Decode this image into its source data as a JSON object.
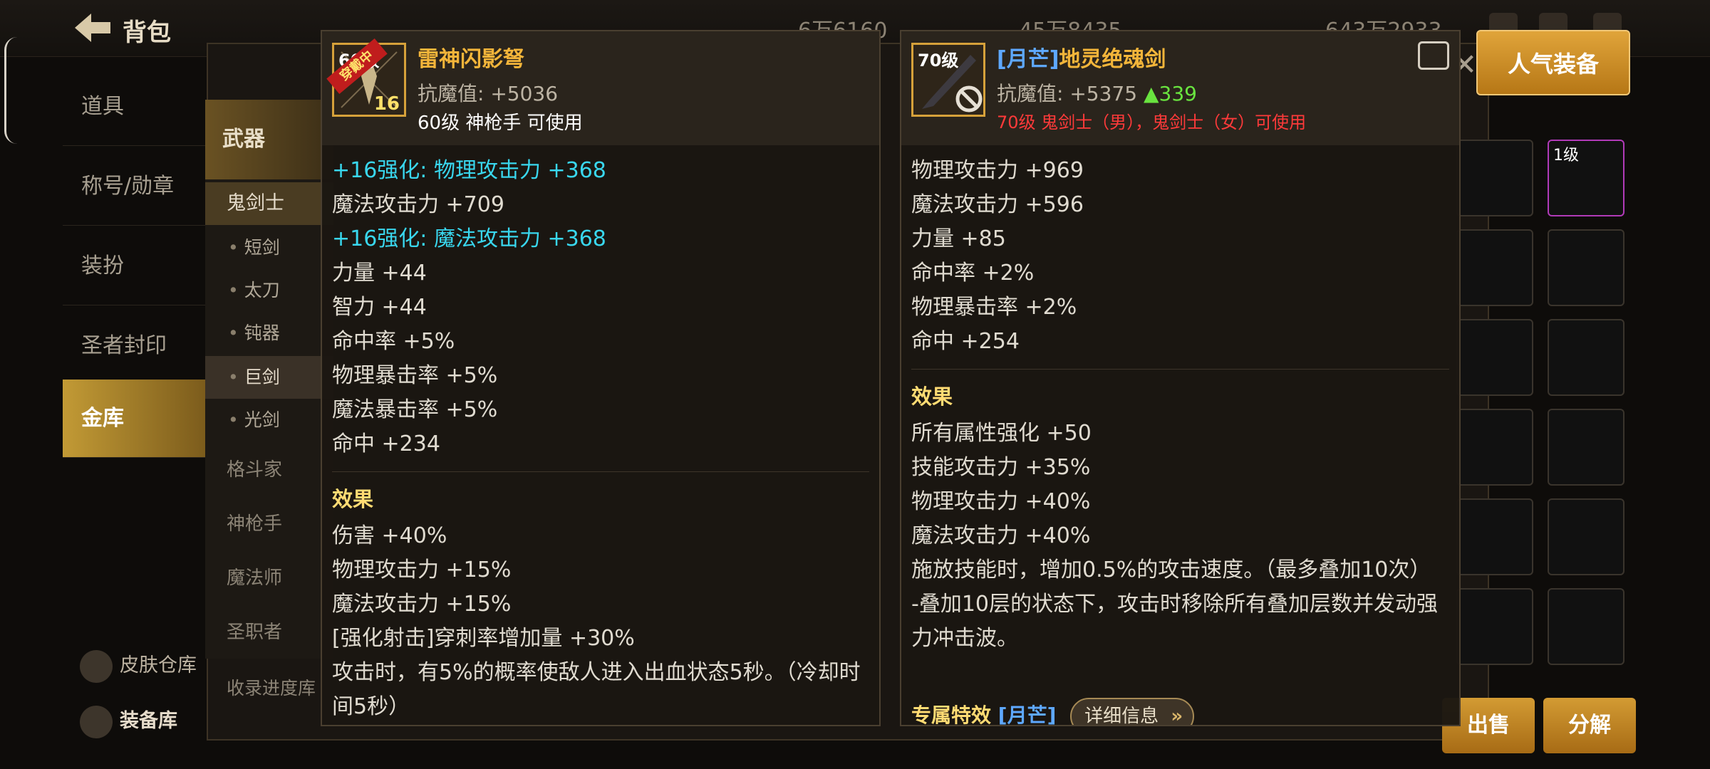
{
  "topbar": {
    "back_title": "背包",
    "currencies": [
      "6万6160",
      "45万8435",
      "643万2933"
    ]
  },
  "left_nav": {
    "items": [
      "道具",
      "称号/勋章",
      "装扮",
      "圣者封印",
      "金库"
    ],
    "active_index": 4,
    "bottom_items": [
      "皮肤仓库",
      "装备库"
    ]
  },
  "sub_nav": {
    "category": "武器",
    "class_selected": "鬼剑士",
    "weapons": [
      "短剑",
      "太刀",
      "钝器",
      "巨剑",
      "光剑"
    ],
    "weapon_selected": "巨剑",
    "other_classes": [
      "格斗家",
      "神枪手",
      "魔法师",
      "圣职者"
    ],
    "collect_label": "收录进度库"
  },
  "buttons": {
    "popular": "人气装备",
    "sell": "出售",
    "decompose": "分解"
  },
  "card_left": {
    "level_badge": "60级",
    "equipped_ribbon": "穿戴中",
    "count": "16",
    "name": "雷神闪影弩",
    "resist": "抗魔值: +5036",
    "requirement": "60级 神枪手 可使用",
    "stats": [
      {
        "text": "+16强化: 物理攻击力 +368",
        "style": "cyan"
      },
      {
        "text": "魔法攻击力 +709",
        "style": "normal"
      },
      {
        "text": "+16强化: 魔法攻击力 +368",
        "style": "cyan"
      },
      {
        "text": "力量 +44",
        "style": "normal"
      },
      {
        "text": "智力 +44",
        "style": "normal"
      },
      {
        "text": "命中率 +5%",
        "style": "normal"
      },
      {
        "text": "物理暴击率 +5%",
        "style": "normal"
      },
      {
        "text": "魔法暴击率 +5%",
        "style": "normal"
      },
      {
        "text": "命中 +234",
        "style": "normal"
      }
    ],
    "effect_title": "效果",
    "effects": [
      "伤害 +40%",
      "物理攻击力 +15%",
      "魔法攻击力 +15%",
      "[强化射击]穿刺率增加量 +30%",
      "攻击时，有5%的概率使敌人进入出血状态5秒。（冷却时间5秒）"
    ]
  },
  "card_right": {
    "level_badge": "70级",
    "name_tag": "[月芒]",
    "name": "地灵绝魂剑",
    "resist": "抗魔值: +5375",
    "resist_diff": "▲339",
    "requirement": "70级 鬼剑士（男），鬼剑士（女）可使用",
    "stats": [
      "物理攻击力 +969",
      "魔法攻击力 +596",
      "力量 +85",
      "命中率 +2%",
      "物理暴击率 +2%",
      "命中 +254"
    ],
    "effect_title": "效果",
    "effects": [
      "所有属性强化 +50",
      "技能攻击力 +35%",
      "物理攻击力 +40%",
      "魔法攻击力 +40%",
      "施放技能时，增加0.5%的攻击速度。（最多叠加10次）",
      "-叠加10层的状态下，攻击时移除所有叠加层数并发动强力冲击波。"
    ],
    "exclusive_label": "专属特效",
    "exclusive_tag": "[月芒]",
    "detail_button": "详细信息"
  },
  "slots": {
    "top_right_level": "1级"
  }
}
